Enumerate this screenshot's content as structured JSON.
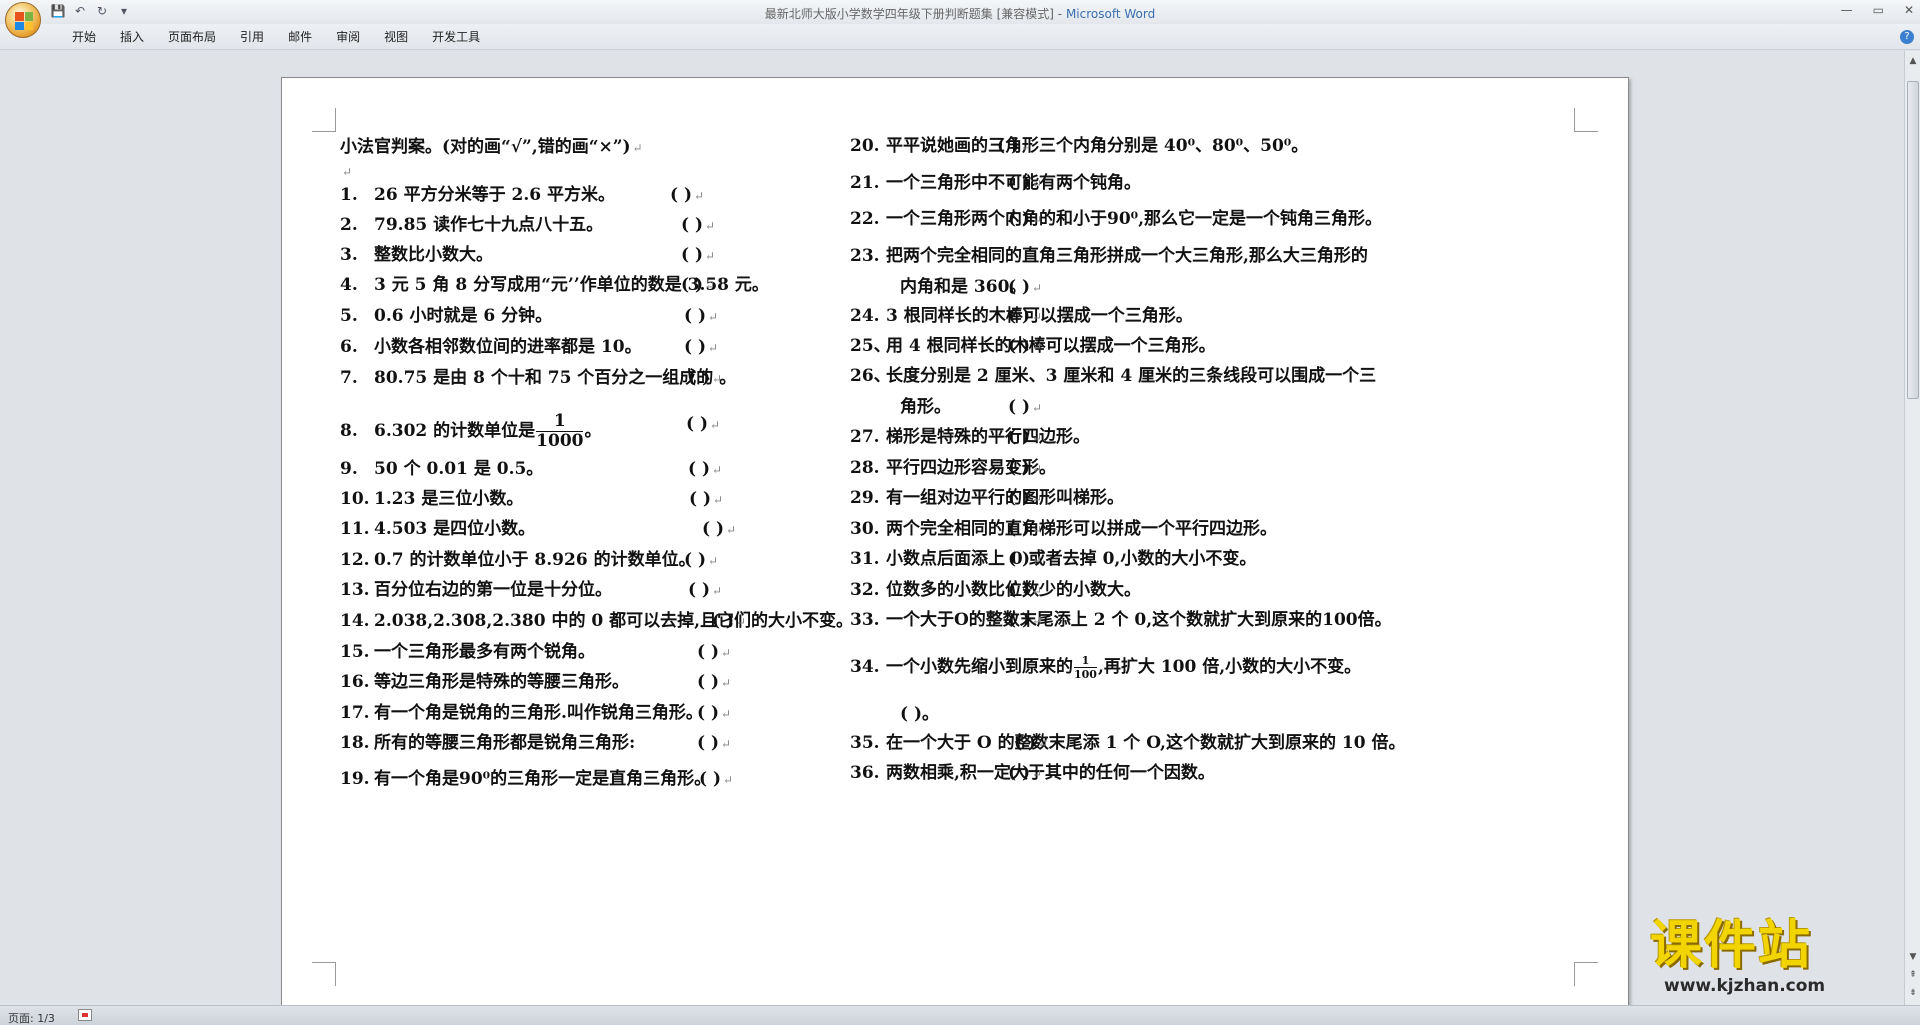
{
  "window": {
    "title_doc": "最新北师大版小学数学四年级下册判断题集 [兼容模式]",
    "title_sep": " - ",
    "title_app": "Microsoft Word",
    "controls": [
      "—",
      "▭",
      "✕"
    ]
  },
  "qat": {
    "save_icon": "save-icon",
    "undo_icon": "undo-icon",
    "redo_icon": "redo-icon",
    "customize_icon": "customize-qat-icon"
  },
  "ribbon": {
    "tabs": [
      "开始",
      "插入",
      "页面布局",
      "引用",
      "邮件",
      "审阅",
      "视图",
      "开发工具"
    ],
    "help": "?"
  },
  "document": {
    "heading": "小法官判案。(对的画“√”,错的画“×”)",
    "left": [
      {
        "n": "1.",
        "t": "26 平方分米等于 2.6 平方米。",
        "p": "(    )"
      },
      {
        "n": "2.",
        "t": "79.85 读作七十九点八十五。",
        "p": "(    )"
      },
      {
        "n": "3.",
        "t": "整数比小数大。",
        "p": "(    )"
      },
      {
        "n": "4.",
        "t": "3 元 5 角 8 分写成用“元’’作单位的数是 3.58 元。",
        "p": "(    )"
      },
      {
        "n": "5.",
        "t": "0.6 小时就是 6 分钟。",
        "p": "(    )"
      },
      {
        "n": "6.",
        "t": "小数各相邻数位间的进率都是 10。",
        "p": "(    )"
      },
      {
        "n": "7.",
        "t": "80.75 是由 8 个十和 75 个百分之一组成的 。",
        "p": "(    )"
      },
      {
        "n": "8.",
        "t": "6.302 的计数单位是",
        "frac_num": "1",
        "frac_den": "1000",
        "t2": "。",
        "p": "(    )"
      },
      {
        "n": "9.",
        "t": "50 个 0.01 是 0.5。",
        "p": "(    )"
      },
      {
        "n": "10.",
        "t": "1.23 是三位小数。",
        "p": "(    )"
      },
      {
        "n": "11.",
        "t": "4.503 是四位小数。",
        "p": "(    )"
      },
      {
        "n": "12.",
        "t": "0.7 的计数单位小于 8.926 的计数单位。",
        "p": "(    )"
      },
      {
        "n": "13.",
        "t": "百分位右边的第一位是十分位。",
        "p": "(    )"
      },
      {
        "n": "14.",
        "t": "2.038,2.308,2.380 中的 0 都可以去掉,且它们的大小不变。",
        "p": "(    )"
      },
      {
        "n": "15.",
        "t": "一个三角形最多有两个锐角。",
        "p": "(    )"
      },
      {
        "n": "16.",
        "t": "等边三角形是特殊的等腰三角形。",
        "p": "(    )"
      },
      {
        "n": "17.",
        "t": "有一个角是锐角的三角形.叫作锐角三角形。",
        "p": "(    )"
      },
      {
        "n": "18.",
        "t": "所有的等腰三角形都是锐角三角形:",
        "p": "(    )"
      },
      {
        "n": "19.",
        "t": "有一个角是90⁰的三角形一定是直角三角形。",
        "p": "(    )"
      }
    ],
    "right": [
      {
        "n": "20.",
        "t": "平平说她画的三角形三个内角分别是 40⁰、80⁰、50⁰。",
        "p": "(    )"
      },
      {
        "n": "21.",
        "t": "一个三角形中不可能有两个钝角。",
        "p": "(    )"
      },
      {
        "n": "22.",
        "t": "一个三角形两个内角的和小于90⁰,那么它一定是一个钝角三角形。",
        "p": "(    )"
      },
      {
        "n": "23.",
        "t": "把两个完全相同的直角三角形拼成一个大三角形,那么大三角形的",
        "t_cont": "内角和是 360。",
        "p": "(    )"
      },
      {
        "n": "24.",
        "t": "3 根同样长的木棒可以摆成一个三角形。",
        "p": "(    )"
      },
      {
        "n": "25、",
        "t": "用 4 根同样长的木棒可以摆成一个三角形。",
        "p": "(    )"
      },
      {
        "n": "26、",
        "t": "长度分别是 2 厘米、3 厘米和 4 厘米的三条线段可以围成一个三",
        "t_cont": "角形。",
        "p": "(    )"
      },
      {
        "n": "27.",
        "t": "梯形是特殊的平行四边形。",
        "p": "(    )"
      },
      {
        "n": "28.",
        "t": "平行四边形容易变形。",
        "p": "(    )"
      },
      {
        "n": "29.",
        "t": "有一组对边平行的图形叫梯形。",
        "p": "(    )"
      },
      {
        "n": "30.",
        "t": "两个完全相同的直角梯形可以拼成一个平行四边形。",
        "p": "(    )"
      },
      {
        "n": "31.",
        "t": "小数点后面添上 0 或者去掉 0,小数的大小不变。",
        "p": "(    )"
      },
      {
        "n": "32.",
        "t": "位数多的小数比位数少的小数大。",
        "p": "(    )"
      },
      {
        "n": "33.",
        "t": "一个大于O的整数末尾添上 2 个 0,这个数就扩大到原来的100倍。",
        "p": "(    )"
      },
      {
        "n": "34.",
        "t": "一个小数先缩小到原来的",
        "frac_num": "1",
        "frac_den": "100",
        "t2": ",再扩大 100 倍,小数的大小不变。",
        "p_cont": "(    )。"
      },
      {
        "n": "35.",
        "t": "在一个大于 O 的整数末尾添 1 个 O,这个数就扩大到原来的 10 倍。",
        "p": "(    )"
      },
      {
        "n": "36.",
        "t": "两数相乘,积一定大于其中的任何一个因数。",
        "p": "(    )"
      }
    ]
  },
  "statusbar": {
    "page": "页面: 1/3"
  },
  "watermark": {
    "title": "课件站",
    "url": "www.kjzhan.com"
  },
  "colors": {
    "app_title": "#3a6eb0",
    "watermark": "#f2d400"
  }
}
